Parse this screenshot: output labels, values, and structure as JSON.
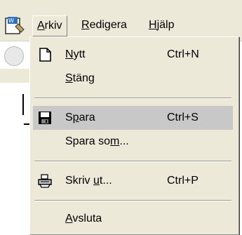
{
  "menubar": {
    "menus": [
      {
        "label": "Arkiv",
        "accel": "A",
        "rest": "rkiv"
      },
      {
        "label": "Redigera",
        "accel": "R",
        "rest": "edigera"
      },
      {
        "label": "Hjälp",
        "accel": "H",
        "rest": "jälp"
      }
    ]
  },
  "file_menu": {
    "items": [
      {
        "label": "Nytt",
        "pre": "",
        "accel": "N",
        "post": "ytt",
        "shortcut": "Ctrl+N",
        "icon": "new-document-icon"
      },
      {
        "label": "Stäng",
        "pre": "",
        "accel": "S",
        "post": "täng",
        "shortcut": "",
        "icon": ""
      },
      {
        "label": "Spara",
        "pre": "S",
        "accel": "p",
        "post": "ara",
        "shortcut": "Ctrl+S",
        "icon": "floppy-disk-icon",
        "highlighted": true
      },
      {
        "label": "Spara som...",
        "pre": "Spara so",
        "accel": "m",
        "post": "...",
        "shortcut": "",
        "icon": ""
      },
      {
        "label": "Skriv ut...",
        "pre": "Skriv ",
        "accel": "u",
        "post": "t...",
        "shortcut": "Ctrl+P",
        "icon": "printer-icon"
      },
      {
        "label": "Avsluta",
        "pre": "",
        "accel": "A",
        "post": "vsluta",
        "shortcut": "",
        "icon": ""
      }
    ]
  },
  "colors": {
    "menu_bg": "#ece9d8",
    "highlight": "#c8c8c8"
  }
}
